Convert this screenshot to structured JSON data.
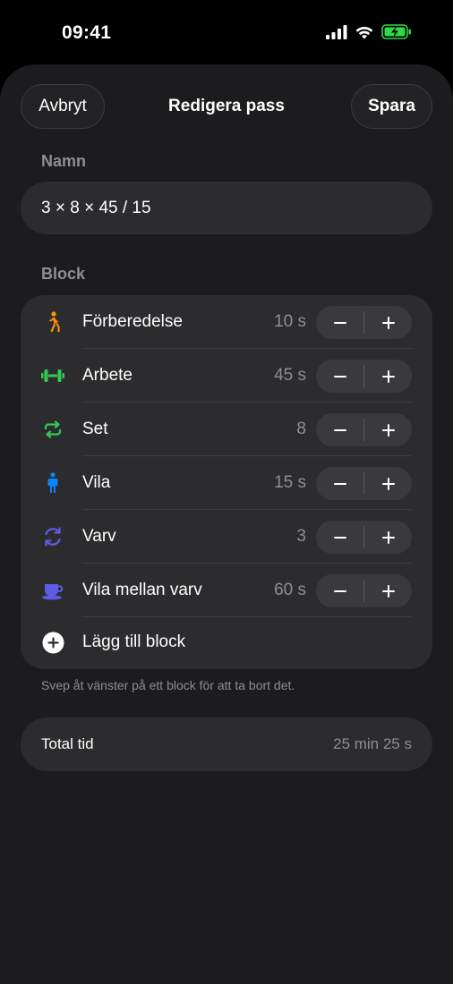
{
  "status": {
    "time": "09:41"
  },
  "nav": {
    "cancel_label": "Avbryt",
    "title": "Redigera pass",
    "save_label": "Spara"
  },
  "name_section": {
    "label": "Namn",
    "value": "3 × 8 × 45 / 15"
  },
  "block_section": {
    "label": "Block",
    "items": [
      {
        "label": "Förberedelse",
        "value": "10 s",
        "icon": "walking-person-icon",
        "color": "#ff9500"
      },
      {
        "label": "Arbete",
        "value": "45 s",
        "icon": "dumbbell-icon",
        "color": "#34c759"
      },
      {
        "label": "Set",
        "value": "8",
        "icon": "repeat-icon",
        "color": "#34c759"
      },
      {
        "label": "Vila",
        "value": "15 s",
        "icon": "standing-person-icon",
        "color": "#0a84ff"
      },
      {
        "label": "Varv",
        "value": "3",
        "icon": "cycle-arrows-icon",
        "color": "#5e5ce6"
      },
      {
        "label": "Vila mellan varv",
        "value": "60 s",
        "icon": "cup-icon",
        "color": "#5e5ce6"
      }
    ],
    "add_label": "Lägg till block",
    "hint": "Svep åt vänster på ett block för att ta bort det."
  },
  "total": {
    "label": "Total tid",
    "value": "25 min 25 s"
  }
}
